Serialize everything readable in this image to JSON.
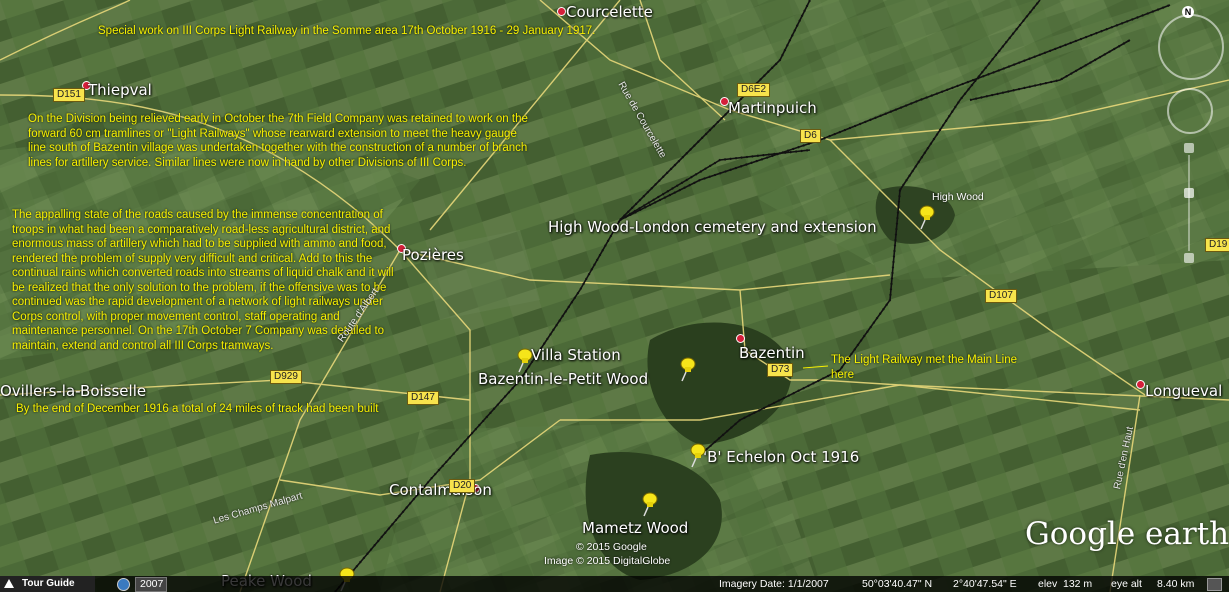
{
  "places": {
    "courcelette": "Courcelette",
    "thiepval": "Thiepval",
    "martinpuich": "Martinpuich",
    "pozieres": "Pozières",
    "high_wood_cemetery": "High Wood-London cemetery and extension",
    "high_wood": "High Wood",
    "bazentin": "Bazentin",
    "villa_station": "Villa Station",
    "bazentin_petit_wood": "Bazentin-le-Petit Wood",
    "ovillers": "Ovillers-la-Boisselle",
    "longueval": "Longueval",
    "b_echelon": "'B' Echelon Oct 1916",
    "contalmaison": "Contalmaison",
    "mametz_wood": "Mametz Wood",
    "peake_wood": "Peake Wood"
  },
  "roads": {
    "d151": "D151",
    "d6e2": "D6E2",
    "d6": "D6",
    "d107": "D107",
    "d19": "D19",
    "d73": "D73",
    "d929": "D929",
    "d147": "D147",
    "d20": "D20"
  },
  "streets": {
    "rue_courcelette": "Rue de Courcelette",
    "route_albert": "Route d'Albert",
    "champs_malpart": "Les Champs Malpart",
    "rue_haut": "Rue d'en Haut"
  },
  "notes": {
    "title": "Special work on III Corps Light Railway in the Somme area 17th October 1916 - 29 January 1917.",
    "para1": "On the Division being relieved early in October the 7th Field Company was retained to work on the forward 60 cm tramlines or \"Light Railways\" whose rearward extension to meet the heavy gauge line south of Bazentin village was undertaken together with the construction of a number of branch lines for artillery service. Similar lines were now in hand by other Divisions of III Corps.",
    "para2": "The appalling state of the roads caused by the immense concentration of troops in what had been a comparatively road-less agricultural district, and enormous mass of artillery which had to be supplied with ammo and food, rendered the problem of supply very difficult and critical. Add to this the continual rains which converted roads into streams of liquid chalk and it will be realized that the only solution to the problem, if the offensive was to be continued was the rapid development of a network of light railways under Corps control, with proper movement control, staff operating and maintenance personnel. On the 17th October 7 Company was detailed to maintain, extend and control all III Corps tramways.",
    "para3": "By the end of December 1916 a total of 24 miles of track had been built",
    "light_railway": "The Light Railway met the Main Line here"
  },
  "attribution": {
    "copyright1": "© 2015 Google",
    "copyright2": "Image © 2015 DigitalGlobe",
    "logo": "Google earth"
  },
  "status": {
    "tour_guide": "Tour Guide",
    "year": "2007",
    "imagery_date": "Imagery Date: 1/1/2007",
    "lat": "50°03'40.47\" N",
    "lon": "2°40'47.54\" E",
    "elev_label": "elev",
    "elev": "132 m",
    "eye_alt_label": "eye alt",
    "eye_alt": "8.40 km"
  },
  "nav": {
    "north": "N"
  },
  "colors": {
    "annotation": "#f7f000",
    "road_badge": "#f7e34c",
    "place_dot": "#d41f3a",
    "railway": "#111111"
  }
}
